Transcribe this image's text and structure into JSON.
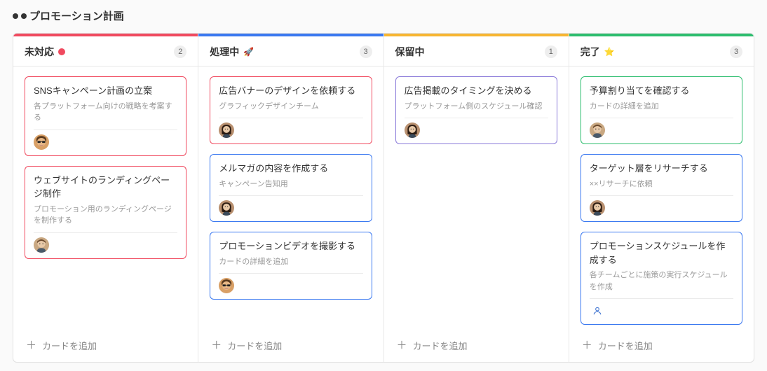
{
  "board": {
    "title": "プロモーション計画"
  },
  "addCardLabel": "カードを追加",
  "columns": [
    {
      "title": "未対応",
      "accent": "#f04a5f",
      "icon": "status-dot",
      "iconColor": "#f04a5f",
      "count": "2",
      "cards": [
        {
          "title": "SNSキャンペーン計画の立案",
          "desc": "各プラットフォーム向けの戦略を考案する",
          "border": "#f04a5f",
          "avatar": "sunglasses"
        },
        {
          "title": "ウェブサイトのランディングページ制作",
          "desc": "プロモーション用のランディングページを制作する",
          "border": "#f04a5f",
          "avatar": "person2"
        }
      ]
    },
    {
      "title": "処理中",
      "accent": "#3a78f0",
      "icon": "rocket",
      "count": "3",
      "cards": [
        {
          "title": "広告バナーのデザインを依頼する",
          "desc": "グラフィックデザインチーム",
          "border": "#f04a5f",
          "avatar": "person3"
        },
        {
          "title": "メルマガの内容を作成する",
          "desc": "キャンペーン告知用",
          "border": "#3a78f0",
          "avatar": "person3"
        },
        {
          "title": "プロモーションビデオを撮影する",
          "desc": "カードの詳細を追加",
          "border": "#3a78f0",
          "avatar": "sunglasses"
        }
      ]
    },
    {
      "title": "保留中",
      "accent": "#f7b531",
      "icon": "none",
      "count": "1",
      "cards": [
        {
          "title": "広告掲載のタイミングを決める",
          "desc": "プラットフォーム側のスケジュール確認",
          "border": "#8a7ad9",
          "avatar": "person3"
        }
      ]
    },
    {
      "title": "完了",
      "accent": "#2dbd6e",
      "icon": "star",
      "count": "3",
      "cards": [
        {
          "title": "予算割り当てを確認する",
          "desc": "カードの詳細を追加",
          "border": "#2dbd6e",
          "avatar": "person2"
        },
        {
          "title": "ターゲット層をリサーチする",
          "desc": "××リサーチに依頼",
          "border": "#3a78f0",
          "avatar": "person3"
        },
        {
          "title": "プロモーションスケジュールを作成する",
          "desc": "各チームごとに施策の実行スケジュールを作成",
          "border": "#3a78f0",
          "avatar": "placeholder"
        }
      ]
    }
  ]
}
